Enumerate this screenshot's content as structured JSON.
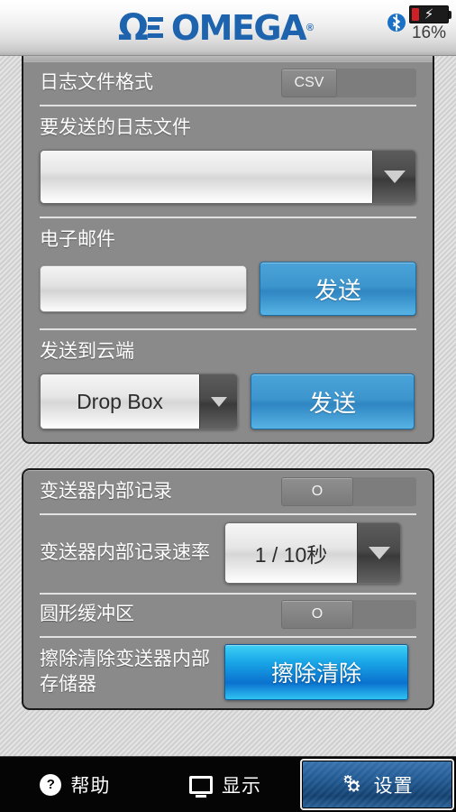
{
  "header": {
    "brand": "OMEGA",
    "brand_registered": "®",
    "omega_symbol": "Ω",
    "bluetooth_icon": "bluetooth-icon",
    "battery_icon": "battery-charging-icon",
    "battery_percent": "16%",
    "accent_blue": "#1d63ae"
  },
  "panel_logging": {
    "rows": [
      {
        "label": "日志文件格式",
        "control": "segmented",
        "options": [
          "CSV"
        ],
        "selected": "CSV"
      },
      {
        "label": "要发送的日志文件",
        "control": "dropdown",
        "value": ""
      },
      {
        "label": "电子邮件",
        "control": "text-input-with-button",
        "value": "",
        "placeholder": "",
        "button_label": "发送"
      },
      {
        "label": "发送到云端",
        "control": "dropdown-with-button",
        "value": "Drop Box",
        "button_label": "发送"
      }
    ]
  },
  "panel_device": {
    "rows": [
      {
        "label": "变送器内部记录",
        "control": "toggle",
        "value": "O"
      },
      {
        "label": "变送器内部记录速率",
        "control": "dropdown",
        "value": "1 / 10秒"
      },
      {
        "label": "圆形缓冲区",
        "control": "toggle",
        "value": "O"
      },
      {
        "label": "擦除清除变送器内部存储器",
        "control": "button",
        "button_label": "擦除清除"
      }
    ]
  },
  "tabbar": {
    "tabs": [
      {
        "label": "帮助",
        "icon": "help-circle-icon",
        "active": false
      },
      {
        "label": "显示",
        "icon": "monitor-icon",
        "active": false
      },
      {
        "label": "设置",
        "icon": "gear-icon",
        "active": true
      }
    ]
  },
  "colors": {
    "accent_blue": "#1d63ae",
    "button_blue": "#3d95cd",
    "erase_blue": "#0a72cf",
    "panel_gray": "#8a8a8a",
    "battery_red": "#cf2026"
  }
}
